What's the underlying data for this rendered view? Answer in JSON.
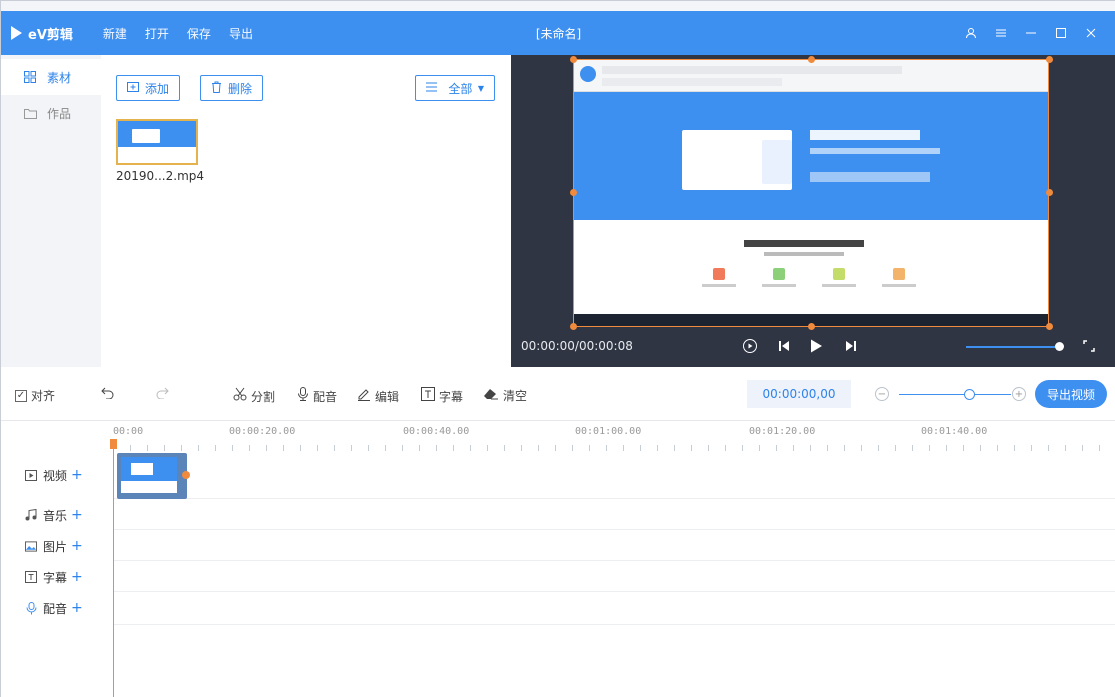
{
  "app": {
    "logo_text": "eV剪辑",
    "menu": [
      "新建",
      "打开",
      "保存",
      "导出"
    ],
    "window_title": "[未命名]"
  },
  "nav": {
    "items": [
      {
        "label": "素材",
        "active": true
      },
      {
        "label": "作品",
        "active": false
      }
    ]
  },
  "media": {
    "add_label": "添加",
    "delete_label": "删除",
    "filter_label": "全部",
    "file_name": "20190...2.mp4"
  },
  "preview": {
    "timecode": "00:00:00/00:00:08"
  },
  "toolbar": {
    "align_label": "对齐",
    "split_label": "分割",
    "dub_label": "配音",
    "edit_label": "编辑",
    "subtitle_label": "字幕",
    "clear_label": "清空",
    "current_time": "00:00:00,00",
    "export_label": "导出视频"
  },
  "timeline": {
    "ruler_labels": [
      "00:00",
      "00:00:20.00",
      "00:00:40.00",
      "00:01:00.00",
      "00:01:20.00",
      "00:01:40.00"
    ],
    "tracks": [
      {
        "label": "视频",
        "icon": "video-track-icon"
      },
      {
        "label": "音乐",
        "icon": "music-note-icon"
      },
      {
        "label": "图片",
        "icon": "image-icon"
      },
      {
        "label": "字幕",
        "icon": "text-box-icon"
      },
      {
        "label": "配音",
        "icon": "microphone-icon"
      }
    ]
  },
  "colors": {
    "accent": "#3d8ff0",
    "handle": "#f08a3c",
    "preview_bg": "#2f3542"
  }
}
